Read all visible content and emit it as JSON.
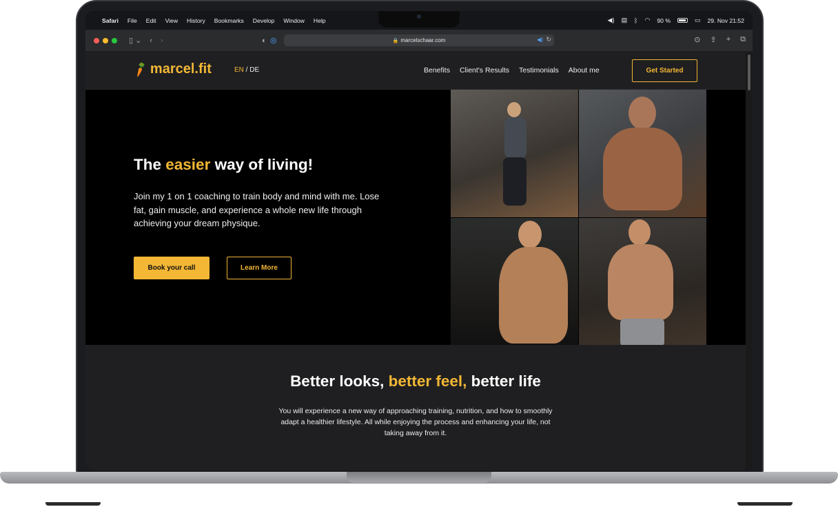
{
  "menubar": {
    "items": [
      "Safari",
      "File",
      "Edit",
      "View",
      "History",
      "Bookmarks",
      "Develop",
      "Window",
      "Help"
    ],
    "battery": "90 %",
    "datetime": "29. Nov  21:52"
  },
  "browser": {
    "url": "marcelschaar.com"
  },
  "site": {
    "logo": "marcel.fit",
    "lang_en": "EN",
    "lang_sep": " / ",
    "lang_de": "DE",
    "nav": [
      "Benefits",
      "Client's Results",
      "Testimonials",
      "About me"
    ],
    "cta": "Get Started",
    "hero": {
      "title_pre": "The ",
      "title_highlight": "easier",
      "title_post": " way of living!",
      "text": "Join my 1 on 1 coaching to train body and mind with me. Lose fat, gain muscle, and experience a whole new life through achieving your dream physique.",
      "btn_primary": "Book your call",
      "btn_secondary": "Learn More"
    },
    "section2": {
      "title_pre": "Better looks, ",
      "title_highlight": "better feel,",
      "title_post": " better life",
      "text": "You will experience a new way of approaching training, nutrition, and how to smoothly adapt a healthier lifestyle. All while enjoying the process and enhancing your life, not taking away from it."
    }
  },
  "colors": {
    "accent": "#f3b735",
    "background": "#000000",
    "nav_bg": "#1f1f21"
  }
}
